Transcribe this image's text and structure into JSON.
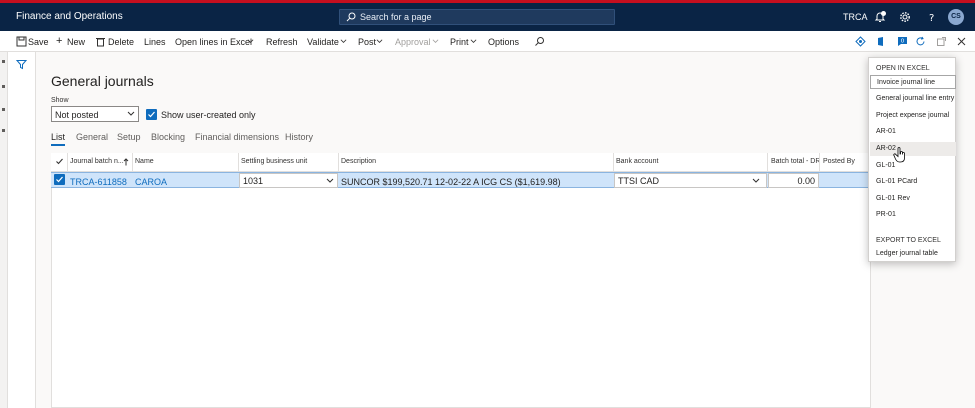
{
  "header": {
    "app_title": "Finance and Operations",
    "search_placeholder": "Search for a page",
    "company": "TRCA",
    "avatar_initials": "CS",
    "bg_color": "#0a2445"
  },
  "actionbar": {
    "save": "Save",
    "new": "New",
    "delete": "Delete",
    "lines": "Lines",
    "open_lines_excel": "Open lines in Excel",
    "refresh": "Refresh",
    "validate": "Validate",
    "post": "Post",
    "approval": "Approval",
    "print": "Print",
    "options": "Options"
  },
  "page": {
    "title": "General journals",
    "show_label": "Show",
    "show_value": "Not posted",
    "show_user_created_label": "Show user-created only",
    "show_user_created_checked": true
  },
  "tabs": [
    "List",
    "General",
    "Setup",
    "Blocking",
    "Financial dimensions",
    "History"
  ],
  "grid": {
    "columns": [
      "Journal batch n...",
      "Name",
      "Settling business unit",
      "Description",
      "Bank account",
      "Batch total - DR",
      "Posted By"
    ],
    "rows": [
      {
        "batch": "TRCA-611858",
        "name": "CAROA",
        "settling_bu": "1031",
        "description": "SUNCOR $199,520.71 12-02-22 A ICG CS ($1,619.98)",
        "bank_account": "TTSI CAD",
        "batch_total": "0.00",
        "posted_by": ""
      }
    ]
  },
  "dropdown": {
    "open_header": "OPEN IN EXCEL",
    "open_items": [
      "Invoice journal line",
      "General journal line entry",
      "Project expense journal",
      "AR-01",
      "AR-02",
      "GL-01",
      "GL-01 PCard",
      "GL-01 Rev",
      "PR-01"
    ],
    "export_header": "EXPORT TO EXCEL",
    "export_items": [
      "Ledger journal table"
    ]
  }
}
